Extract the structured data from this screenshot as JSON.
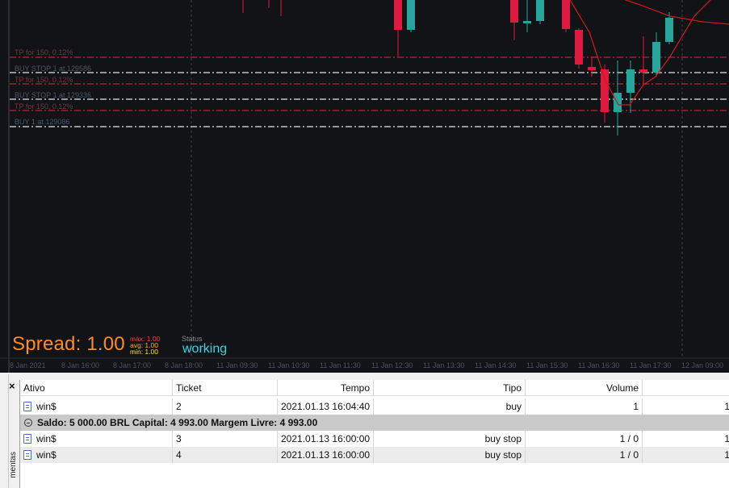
{
  "chart": {
    "level_labels": [
      {
        "text": "TP for 150, 0.12%",
        "kind": "tp"
      },
      {
        "text": "BUY STOP 1 at 129586",
        "kind": "buy"
      },
      {
        "text": "TP for 150, 0.12%",
        "kind": "tp"
      },
      {
        "text": "BUY STOP 1 at 129336",
        "kind": "buy"
      },
      {
        "text": "TP for 150, 0.12%",
        "kind": "tp"
      },
      {
        "text": "BUY 1 at 129086",
        "kind": "buy"
      }
    ],
    "spread_label": "Spread: 1.00",
    "stats": {
      "max": "max: 1.00",
      "avg": "avg:  1.00",
      "min": "min:  1.00"
    },
    "status_caption": "Status",
    "status_value": "working",
    "time_axis": [
      "8 Jan 2021",
      "8 Jan 16:00",
      "8 Jan 17:00",
      "8 Jan 18:00",
      "11 Jan 09:30",
      "11 Jan 10:30",
      "11 Jan 11:30",
      "11 Jan 12:30",
      "11 Jan 13:30",
      "11 Jan 14:30",
      "11 Jan 15:30",
      "11 Jan 16:30",
      "11 Jan 17:30",
      "12 Jan 09:00"
    ],
    "colors": {
      "bull": "#26a69a",
      "bear": "#e0193f",
      "ma": "#d11a1a",
      "tp_line": "#c0223a",
      "order_line": "#e6e6e6"
    }
  },
  "toolbox": {
    "close_glyph": "×",
    "vertical_label": "mentas",
    "columns": [
      "Ativo",
      "Ticket",
      "Tempo",
      "Tipo",
      "Volume"
    ],
    "positions": [
      {
        "ativo": "win$",
        "ticket": "2",
        "tempo": "2021.01.13 16:04:40",
        "tipo": "buy",
        "volume": "1",
        "extra": "1"
      }
    ],
    "summary": "Saldo: 5 000.00 BRL  Capital: 4 993.00  Margem Livre: 4 993.00",
    "orders": [
      {
        "ativo": "win$",
        "ticket": "3",
        "tempo": "2021.01.13 16:00:00",
        "tipo": "buy stop",
        "volume": "1 / 0",
        "extra": "1"
      },
      {
        "ativo": "win$",
        "ticket": "4",
        "tempo": "2021.01.13 16:00:00",
        "tipo": "buy stop",
        "volume": "1 / 0",
        "extra": "1"
      }
    ]
  }
}
